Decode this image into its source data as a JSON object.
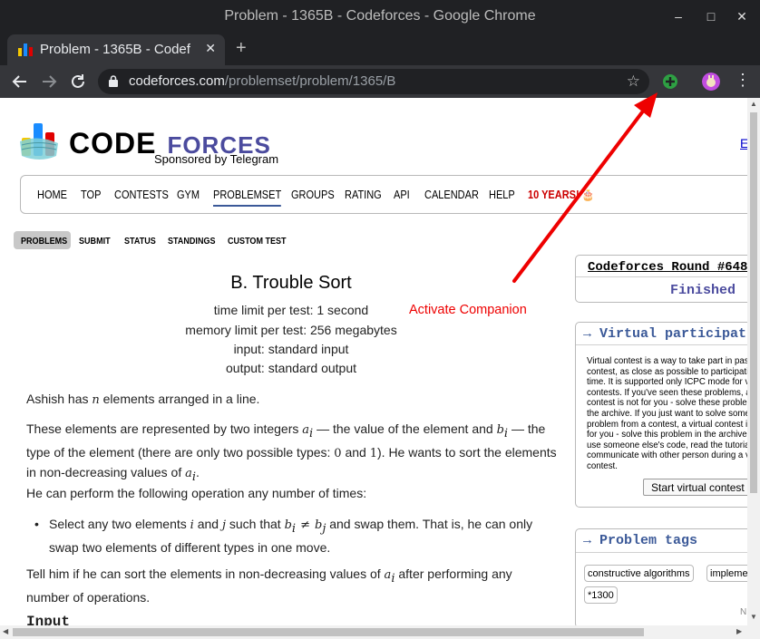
{
  "window": {
    "title": "Problem - 1365B - Codeforces - Google Chrome",
    "min_glyph": "–",
    "max_glyph": "□",
    "close_glyph": "✕"
  },
  "tab": {
    "label": "Problem - 1365B - Codef",
    "close_glyph": "✕",
    "new_tab_glyph": "+"
  },
  "toolbar": {
    "url_host": "codeforces.com",
    "url_path": "/problemset/problem/1365/B",
    "star_glyph": "☆",
    "menu_glyph": "⋮"
  },
  "header": {
    "logo_code": "CODE",
    "logo_forces": "FORCES",
    "sponsor": "Sponsored by Telegram",
    "lang_link": "E"
  },
  "menu": {
    "items": [
      "HOME",
      "TOP",
      "CONTESTS",
      "GYM",
      "PROBLEMSET",
      "GROUPS",
      "RATING",
      "API",
      "CALENDAR",
      "HELP"
    ],
    "years": "10 YEARS! 🎂",
    "active": "PROBLEMSET"
  },
  "submenu": {
    "items": [
      "PROBLEMS",
      "SUBMIT",
      "STATUS",
      "STANDINGS",
      "CUSTOM TEST"
    ],
    "active": "PROBLEMS"
  },
  "problem": {
    "title": "B. Trouble Sort",
    "time_limit": "time limit per test: 1 second",
    "memory_limit": "memory limit per test: 256 megabytes",
    "input": "input: standard input",
    "output": "output: standard output",
    "p1_a": "Ashish has ",
    "p1_var": "n",
    "p1_b": " elements arranged in a line.",
    "p2_a": "These elements are represented by two integers ",
    "p2_b": " — the value of the element and ",
    "p2_c": " — the type of the element (there are only two possible types: ",
    "p2_d": " and ",
    "p2_e": "). He wants to sort the elements in non-decreasing values of ",
    "p2_f": ".",
    "p3": "He can perform the following operation any number of times:",
    "li_a": "Select any two elements ",
    "li_b": " and ",
    "li_c": " such that ",
    "li_d": " and swap them. That is, he can only swap two elements of different types in one move.",
    "p4_a": "Tell him if he can sort the elements in non-decreasing values of ",
    "p4_b": " after performing any number of operations.",
    "input_heading": "Input",
    "var_a": "a",
    "var_b": "b",
    "var_i": "i",
    "var_j": "j",
    "zero": "0",
    "one": "1",
    "neq": "≠",
    "bullet": "•"
  },
  "annotation": {
    "label": "Activate Companion",
    "color": "#ee0000"
  },
  "sidebar": {
    "round_name": "Codeforces Round #648",
    "round_status": "Finished",
    "virtual_header": "→ Virtual participat",
    "virtual_text": "Virtual contest is a way to take part in past contest, as close as possible to participation on time. It is supported only ICPC mode for virtual contests. If you've seen these problems, a virtual contest is not for you - solve these problems in the archive. If you just want to solve some problem from a contest, a virtual contest is not for you - solve this problem in the archive. Never use someone else's code, read the tutorials or communicate with other person during a virtual contest.",
    "virtual_button": "Start virtual contest",
    "tags_header": "→ Problem tags",
    "tags": [
      "constructive algorithms",
      "implementation",
      "*1300"
    ],
    "tags_more": "N"
  }
}
